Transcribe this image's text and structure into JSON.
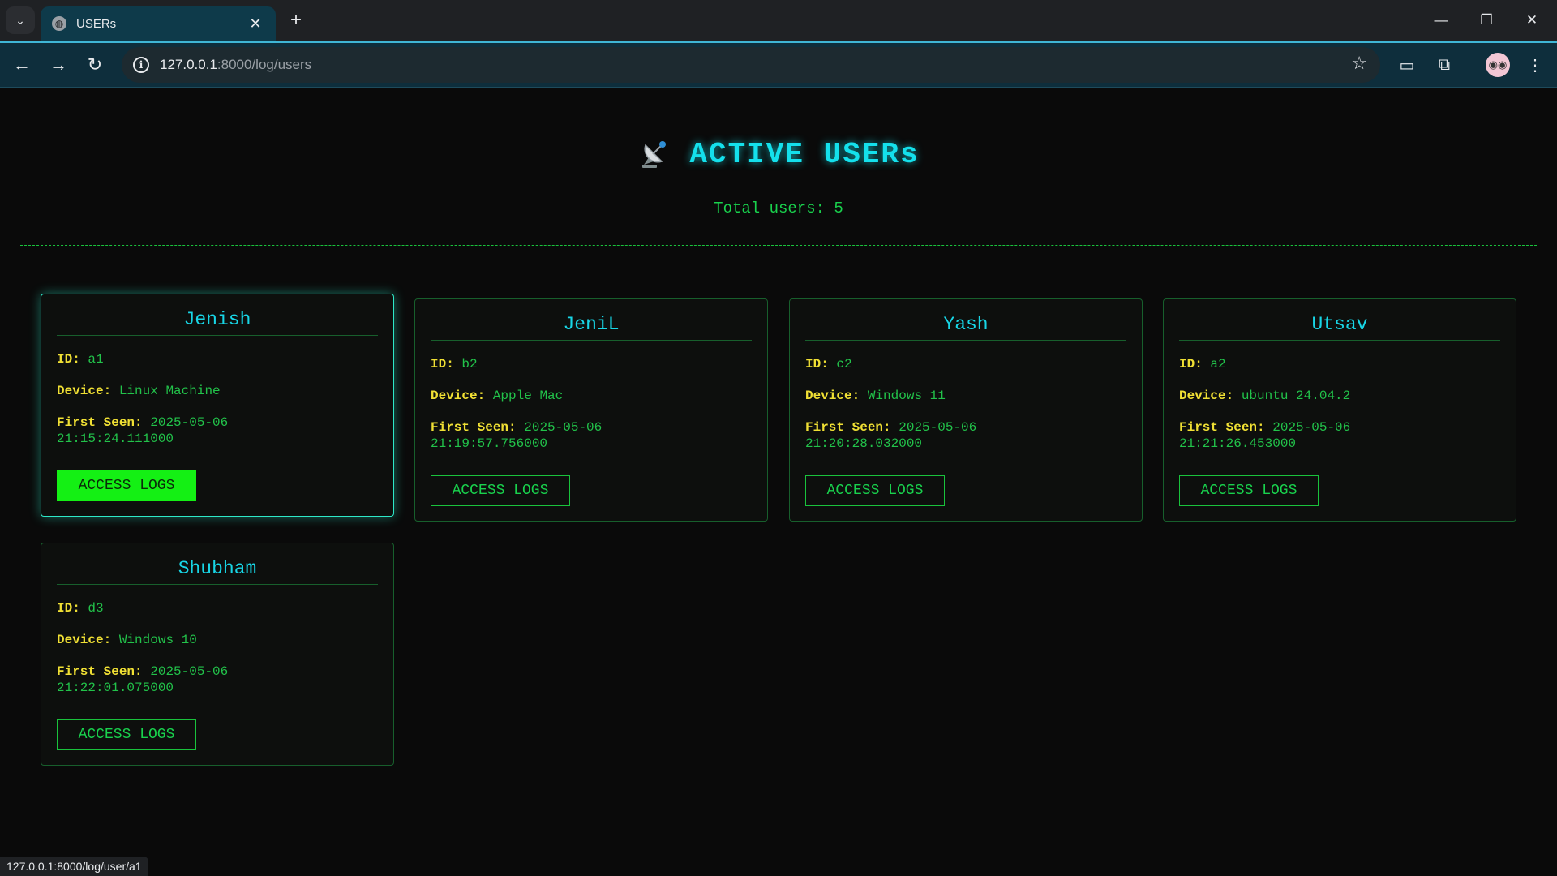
{
  "browser": {
    "tab_title": "USERs",
    "url_host": "127.0.0.1",
    "url_rest": ":8000/log/users",
    "status_url": "127.0.0.1:8000/log/user/a1"
  },
  "page": {
    "title": "ACTIVE USERs",
    "total_users": "Total users: 5"
  },
  "labels": {
    "id": "ID:",
    "device": "Device:",
    "first_seen": "First Seen:",
    "button": "ACCESS LOGS"
  },
  "users": [
    {
      "name": "Jenish",
      "id": "a1",
      "device": "Linux Machine",
      "first_seen_date": "2025-05-06",
      "first_seen_time": "21:15:24.111000"
    },
    {
      "name": "JeniL",
      "id": "b2",
      "device": "Apple Mac",
      "first_seen_date": "2025-05-06",
      "first_seen_time": "21:19:57.756000"
    },
    {
      "name": "Yash",
      "id": "c2",
      "device": "Windows 11",
      "first_seen_date": "2025-05-06",
      "first_seen_time": "21:20:28.032000"
    },
    {
      "name": "Utsav",
      "id": "a2",
      "device": "ubuntu 24.04.2",
      "first_seen_date": "2025-05-06",
      "first_seen_time": "21:21:26.453000"
    },
    {
      "name": "Shubham",
      "id": "d3",
      "device": "Windows 10",
      "first_seen_date": "2025-05-06",
      "first_seen_time": "21:22:01.075000"
    }
  ],
  "colors": {
    "title": "#14e0ec",
    "text_green": "#19d24d",
    "label_yellow": "#f0e034",
    "active_button": "#14f014"
  }
}
